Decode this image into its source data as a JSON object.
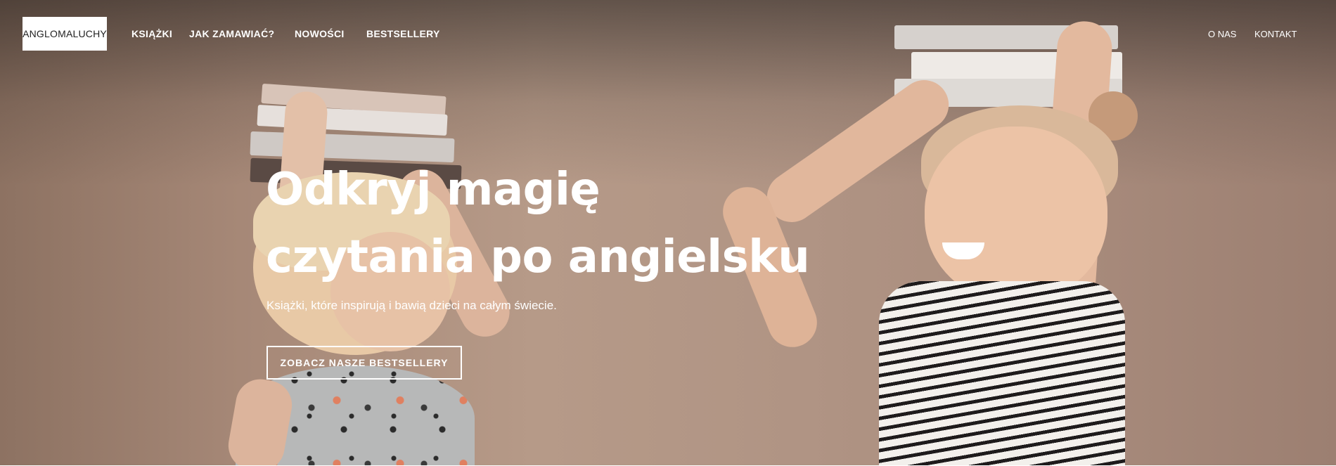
{
  "header": {
    "logo_text": "ANGLOMALUCHY",
    "nav_left": [
      {
        "label": "KSIĄŻKI"
      },
      {
        "label": "JAK ZAMAWIAĆ?"
      },
      {
        "label": "NOWOŚCI"
      },
      {
        "label": "BESTSELLERY"
      }
    ],
    "nav_right": [
      {
        "label": "O NAS"
      },
      {
        "label": "KONTAKT"
      }
    ]
  },
  "hero": {
    "headline_line1": "Odkryj magię",
    "headline_line2": "czytania po angielsku",
    "subtitle": "Książki, które inspirują i bawią dzieci na całym świecie.",
    "cta_label": "ZOBACZ NASZE BESTSELLERY",
    "background_image": "two children balancing stacks of books on their heads"
  },
  "colors": {
    "overlay_dark": "#2a2422",
    "background_warm": "#a68877",
    "text": "#ffffff"
  }
}
